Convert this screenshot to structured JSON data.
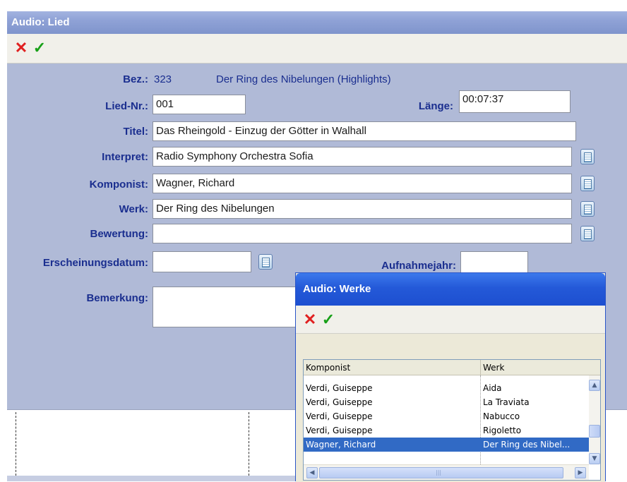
{
  "main": {
    "title": "Audio: Lied",
    "toolbar": {
      "cancel_icon": "red-x-icon",
      "ok_icon": "green-check-icon"
    },
    "bez": {
      "label": "Bez.:",
      "number": "323",
      "album": "Der Ring des Nibelungen (Highlights)"
    },
    "lied_nr": {
      "label": "Lied-Nr.:",
      "value": "001"
    },
    "laenge": {
      "label": "Länge:",
      "value": "00:07:37"
    },
    "titel": {
      "label": "Titel:",
      "value": "Das Rheingold - Einzug der Götter in Walhall"
    },
    "interpret": {
      "label": "Interpret:",
      "value": "Radio Symphony Orchestra Sofia"
    },
    "komponist": {
      "label": "Komponist:",
      "value": "Wagner, Richard"
    },
    "werk": {
      "label": "Werk:",
      "value": "Der Ring des Nibelungen"
    },
    "bewertung": {
      "label": "Bewertung:",
      "value": ""
    },
    "erscheinungsdatum": {
      "label": "Erscheinungsdatum:",
      "value": ""
    },
    "aufnahmejahr": {
      "label": "Aufnahmejahr:",
      "value": ""
    },
    "bemerkung": {
      "label": "Bemerkung:",
      "value": ""
    }
  },
  "popup": {
    "title": "Audio: Werke",
    "columns": [
      "Komponist",
      "Werk"
    ],
    "rows": [
      {
        "komponist": "Verdi, Guiseppe",
        "werk": "Aida",
        "selected": false
      },
      {
        "komponist": "Verdi, Guiseppe",
        "werk": "La Traviata",
        "selected": false
      },
      {
        "komponist": "Verdi, Guiseppe",
        "werk": "Nabucco",
        "selected": false
      },
      {
        "komponist": "Verdi, Guiseppe",
        "werk": "Rigoletto",
        "selected": false
      },
      {
        "komponist": "Wagner, Richard",
        "werk": "Der Ring des Nibel...",
        "selected": true
      }
    ]
  },
  "colors": {
    "accent": "#1a2e8f",
    "selection": "#316ac5",
    "form_bg": "#b0bad7"
  }
}
